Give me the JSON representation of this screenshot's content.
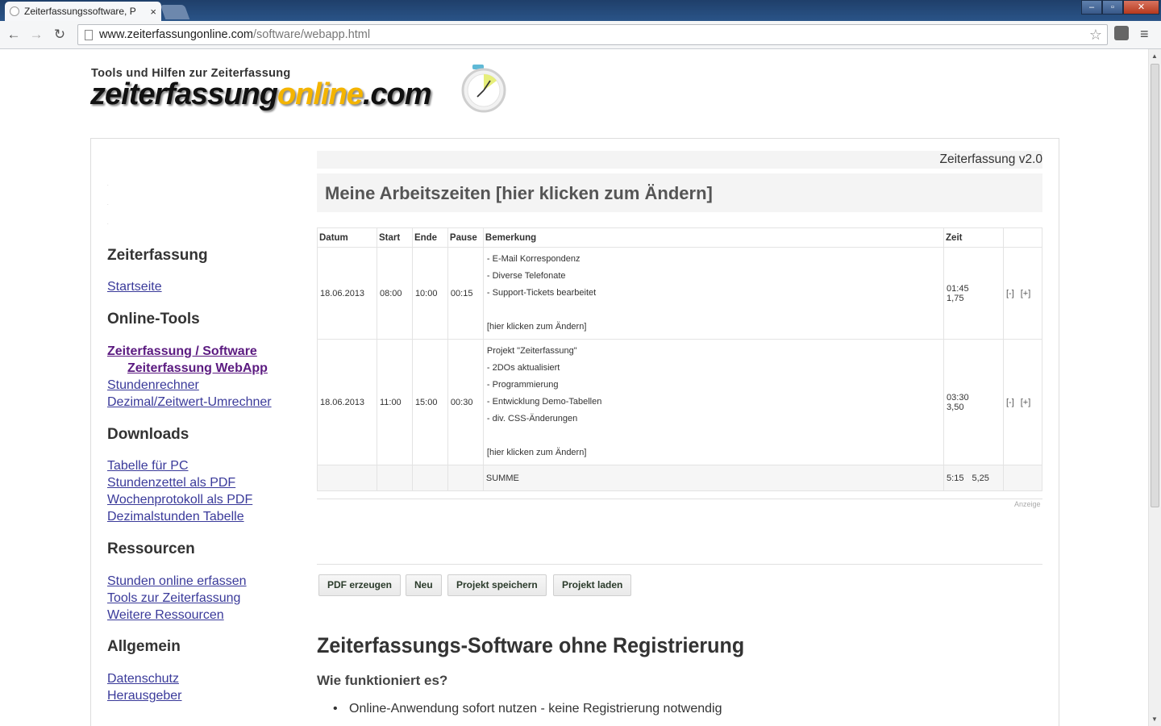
{
  "browser": {
    "tab_title": "Zeiterfassungssoftware, P",
    "tab_close": "×",
    "url_host": "www.zeiterfassungonline.com",
    "url_path": "/software/webapp.html",
    "back_icon": "←",
    "forward_icon": "→",
    "reload_icon": "↻",
    "star_icon": "☆",
    "menu_icon": "≡",
    "win_min": "–",
    "win_max": "▫",
    "win_close": "✕"
  },
  "logo": {
    "tagline": "Tools und Hilfen zur Zeiterfassung",
    "part1": "zeiterfassung",
    "part2": "online",
    "part3": ".com",
    "accent_color": "#f4b400"
  },
  "sidebar": {
    "sections": [
      {
        "title": "Zeiterfassung",
        "links": [
          "Startseite"
        ]
      },
      {
        "title": "Online-Tools",
        "links": [
          "Zeiterfassung / Software",
          "Zeiterfassung WebApp",
          "Stundenrechner",
          "Dezimal/Zeitwert-Umrechner"
        ]
      },
      {
        "title": "Downloads",
        "links": [
          "Tabelle für PC",
          "Stundenzettel als PDF",
          "Wochenprotokoll als PDF",
          "Dezimalstunden Tabelle"
        ]
      },
      {
        "title": "Ressourcen",
        "links": [
          "Stunden online erfassen",
          "Tools zur Zeiterfassung",
          "Weitere Ressourcen"
        ]
      },
      {
        "title": "Allgemein",
        "links": [
          "Datenschutz",
          "Herausgeber"
        ]
      }
    ]
  },
  "app": {
    "version": "Zeiterfassung v2.0",
    "heading": "Meine Arbeitszeiten [hier klicken zum Ändern]",
    "columns": [
      "Datum",
      "Start",
      "Ende",
      "Pause",
      "Bemerkung",
      "Zeit",
      ""
    ],
    "rows": [
      {
        "datum": "18.06.2013",
        "start": "08:00",
        "ende": "10:00",
        "pause": "00:15",
        "bemerkung": [
          "- E-Mail Korrespondenz",
          "- Diverse Telefonate",
          "- Support-Tickets bearbeitet",
          "",
          "[hier klicken zum Ändern]"
        ],
        "zeit": "01:45",
        "dezimal": "1,75",
        "minus": "[-]",
        "plus": "[+]"
      },
      {
        "datum": "18.06.2013",
        "start": "11:00",
        "ende": "15:00",
        "pause": "00:30",
        "bemerkung": [
          "Projekt \"Zeiterfassung\"",
          "- 2DOs aktualisiert",
          "- Programmierung",
          "- Entwicklung Demo-Tabellen",
          "- div. CSS-Änderungen",
          "",
          "[hier klicken zum Ändern]"
        ],
        "zeit": "03:30",
        "dezimal": "3,50",
        "minus": "[-]",
        "plus": "[+]"
      }
    ],
    "sum": {
      "label": "SUMME",
      "zeit": "5:15",
      "dezimal": "5,25"
    },
    "ad_label": "Anzeige",
    "buttons": {
      "pdf": "PDF erzeugen",
      "neu": "Neu",
      "save": "Projekt speichern",
      "load": "Projekt laden"
    }
  },
  "section": {
    "title": "Zeiterfassungs-Software ohne Registrierung",
    "subtitle": "Wie funktioniert es?",
    "bullets": [
      "Online-Anwendung sofort nutzen - keine Registrierung notwendig"
    ]
  }
}
